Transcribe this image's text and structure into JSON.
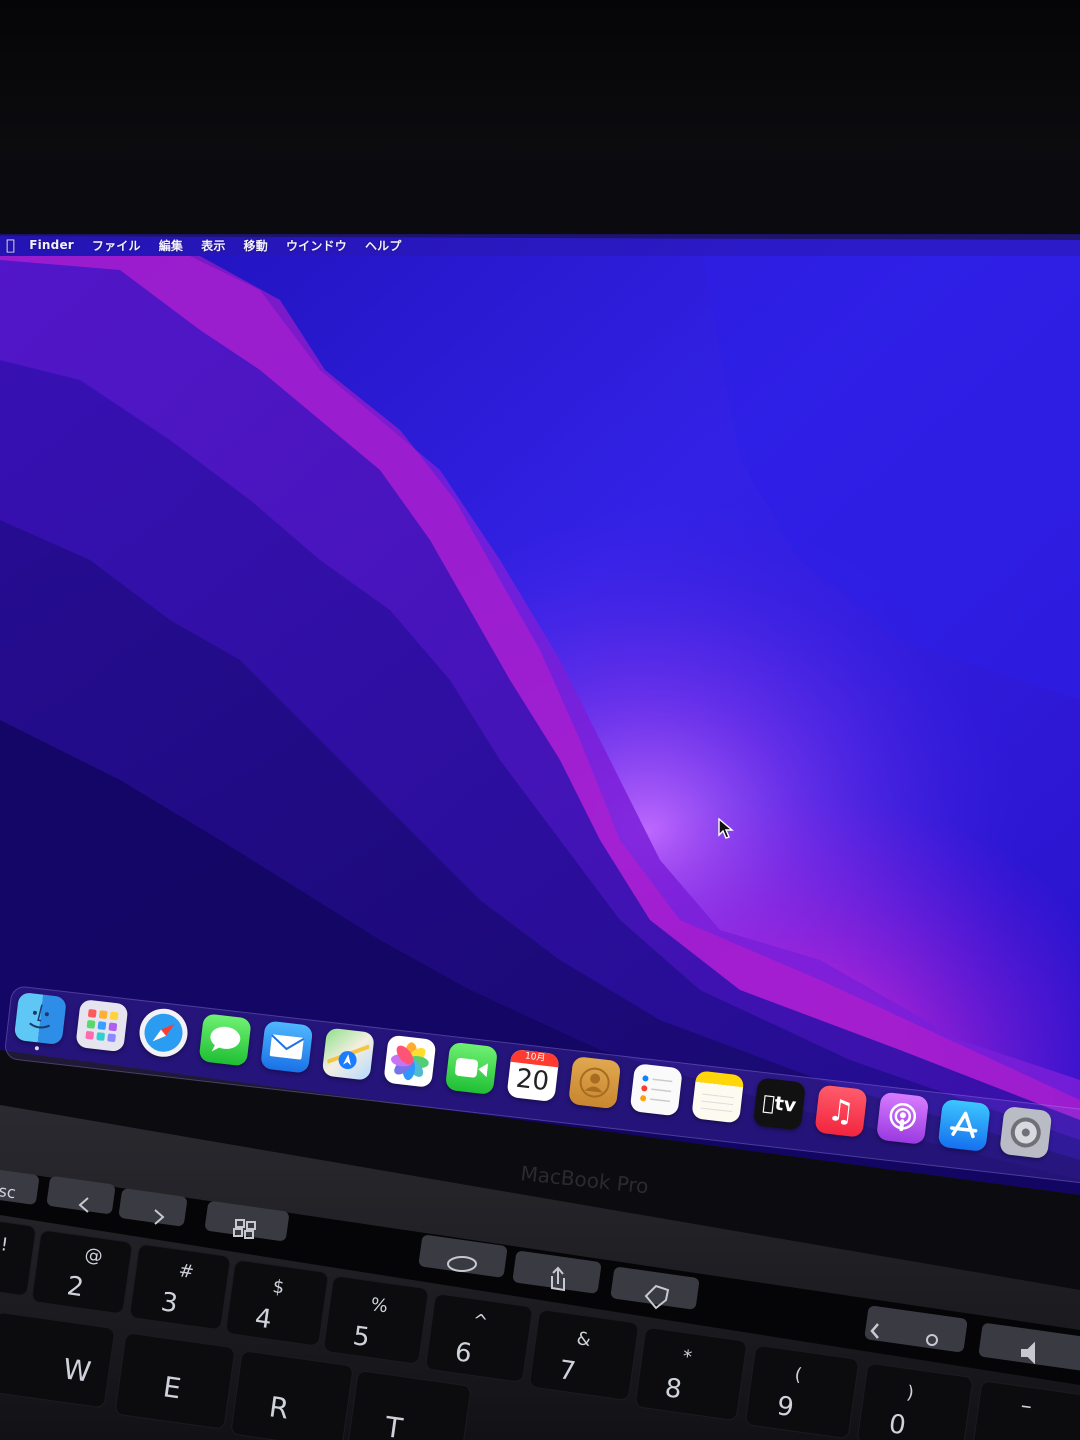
{
  "menubar": {
    "apple_icon": "apple-logo-icon",
    "items": [
      "Finder",
      "ファイル",
      "編集",
      "表示",
      "移動",
      "ウインドウ",
      "ヘルプ"
    ]
  },
  "dock": {
    "apps": [
      {
        "name": "finder",
        "icon": "finder-icon"
      },
      {
        "name": "launchpad",
        "icon": "launchpad-icon"
      },
      {
        "name": "safari",
        "icon": "safari-icon"
      },
      {
        "name": "messages",
        "icon": "messages-icon"
      },
      {
        "name": "mail",
        "icon": "mail-icon"
      },
      {
        "name": "maps",
        "icon": "maps-icon"
      },
      {
        "name": "photos",
        "icon": "photos-icon"
      },
      {
        "name": "facetime",
        "icon": "facetime-icon"
      },
      {
        "name": "calendar",
        "icon": "calendar-icon",
        "month": "10月",
        "day": "20"
      },
      {
        "name": "contacts",
        "icon": "contacts-icon"
      },
      {
        "name": "reminders",
        "icon": "reminders-icon"
      },
      {
        "name": "notes",
        "icon": "notes-icon"
      },
      {
        "name": "tv",
        "icon": "apple-tv-icon",
        "label": "tv"
      },
      {
        "name": "music",
        "icon": "music-icon"
      },
      {
        "name": "podcasts",
        "icon": "podcasts-icon"
      },
      {
        "name": "app-store",
        "icon": "app-store-icon"
      },
      {
        "name": "system-preferences",
        "icon": "gear-icon"
      }
    ]
  },
  "laptop": {
    "bezel_label": "MacBook Pro"
  },
  "keyboard": {
    "esc": "sc",
    "row1": [
      {
        "top": "!",
        "bottom": ""
      },
      {
        "top": "@",
        "bottom": "2"
      },
      {
        "top": "#",
        "bottom": "3"
      },
      {
        "top": "$",
        "bottom": "4"
      },
      {
        "top": "%",
        "bottom": "5"
      },
      {
        "top": "^",
        "bottom": "6"
      },
      {
        "top": "&",
        "bottom": "7"
      },
      {
        "top": "*",
        "bottom": "8"
      },
      {
        "top": "(",
        "bottom": "9"
      },
      {
        "top": ")",
        "bottom": "0"
      }
    ],
    "row2": [
      "W",
      "E",
      "R",
      "T"
    ],
    "minus": "–"
  },
  "colors": {
    "wallpaper_blue": "#2a12d8",
    "wallpaper_magenta": "#d01ed8",
    "wallpaper_dark": "#17086a"
  }
}
